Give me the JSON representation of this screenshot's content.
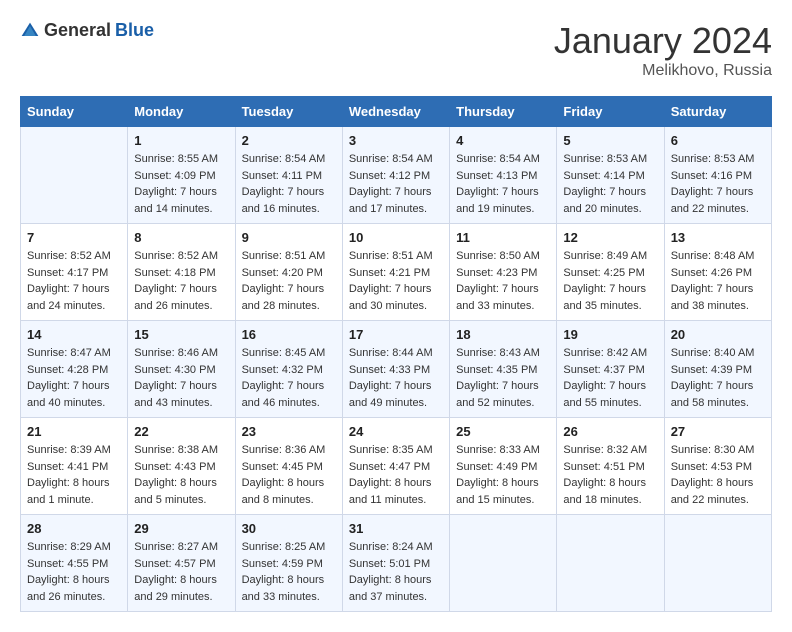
{
  "header": {
    "logo_general": "General",
    "logo_blue": "Blue",
    "month": "January 2024",
    "location": "Melikhovo, Russia"
  },
  "days_of_week": [
    "Sunday",
    "Monday",
    "Tuesday",
    "Wednesday",
    "Thursday",
    "Friday",
    "Saturday"
  ],
  "weeks": [
    [
      {
        "day": "",
        "sunrise": "",
        "sunset": "",
        "daylight": ""
      },
      {
        "day": "1",
        "sunrise": "Sunrise: 8:55 AM",
        "sunset": "Sunset: 4:09 PM",
        "daylight": "Daylight: 7 hours and 14 minutes."
      },
      {
        "day": "2",
        "sunrise": "Sunrise: 8:54 AM",
        "sunset": "Sunset: 4:11 PM",
        "daylight": "Daylight: 7 hours and 16 minutes."
      },
      {
        "day": "3",
        "sunrise": "Sunrise: 8:54 AM",
        "sunset": "Sunset: 4:12 PM",
        "daylight": "Daylight: 7 hours and 17 minutes."
      },
      {
        "day": "4",
        "sunrise": "Sunrise: 8:54 AM",
        "sunset": "Sunset: 4:13 PM",
        "daylight": "Daylight: 7 hours and 19 minutes."
      },
      {
        "day": "5",
        "sunrise": "Sunrise: 8:53 AM",
        "sunset": "Sunset: 4:14 PM",
        "daylight": "Daylight: 7 hours and 20 minutes."
      },
      {
        "day": "6",
        "sunrise": "Sunrise: 8:53 AM",
        "sunset": "Sunset: 4:16 PM",
        "daylight": "Daylight: 7 hours and 22 minutes."
      }
    ],
    [
      {
        "day": "7",
        "sunrise": "Sunrise: 8:52 AM",
        "sunset": "Sunset: 4:17 PM",
        "daylight": "Daylight: 7 hours and 24 minutes."
      },
      {
        "day": "8",
        "sunrise": "Sunrise: 8:52 AM",
        "sunset": "Sunset: 4:18 PM",
        "daylight": "Daylight: 7 hours and 26 minutes."
      },
      {
        "day": "9",
        "sunrise": "Sunrise: 8:51 AM",
        "sunset": "Sunset: 4:20 PM",
        "daylight": "Daylight: 7 hours and 28 minutes."
      },
      {
        "day": "10",
        "sunrise": "Sunrise: 8:51 AM",
        "sunset": "Sunset: 4:21 PM",
        "daylight": "Daylight: 7 hours and 30 minutes."
      },
      {
        "day": "11",
        "sunrise": "Sunrise: 8:50 AM",
        "sunset": "Sunset: 4:23 PM",
        "daylight": "Daylight: 7 hours and 33 minutes."
      },
      {
        "day": "12",
        "sunrise": "Sunrise: 8:49 AM",
        "sunset": "Sunset: 4:25 PM",
        "daylight": "Daylight: 7 hours and 35 minutes."
      },
      {
        "day": "13",
        "sunrise": "Sunrise: 8:48 AM",
        "sunset": "Sunset: 4:26 PM",
        "daylight": "Daylight: 7 hours and 38 minutes."
      }
    ],
    [
      {
        "day": "14",
        "sunrise": "Sunrise: 8:47 AM",
        "sunset": "Sunset: 4:28 PM",
        "daylight": "Daylight: 7 hours and 40 minutes."
      },
      {
        "day": "15",
        "sunrise": "Sunrise: 8:46 AM",
        "sunset": "Sunset: 4:30 PM",
        "daylight": "Daylight: 7 hours and 43 minutes."
      },
      {
        "day": "16",
        "sunrise": "Sunrise: 8:45 AM",
        "sunset": "Sunset: 4:32 PM",
        "daylight": "Daylight: 7 hours and 46 minutes."
      },
      {
        "day": "17",
        "sunrise": "Sunrise: 8:44 AM",
        "sunset": "Sunset: 4:33 PM",
        "daylight": "Daylight: 7 hours and 49 minutes."
      },
      {
        "day": "18",
        "sunrise": "Sunrise: 8:43 AM",
        "sunset": "Sunset: 4:35 PM",
        "daylight": "Daylight: 7 hours and 52 minutes."
      },
      {
        "day": "19",
        "sunrise": "Sunrise: 8:42 AM",
        "sunset": "Sunset: 4:37 PM",
        "daylight": "Daylight: 7 hours and 55 minutes."
      },
      {
        "day": "20",
        "sunrise": "Sunrise: 8:40 AM",
        "sunset": "Sunset: 4:39 PM",
        "daylight": "Daylight: 7 hours and 58 minutes."
      }
    ],
    [
      {
        "day": "21",
        "sunrise": "Sunrise: 8:39 AM",
        "sunset": "Sunset: 4:41 PM",
        "daylight": "Daylight: 8 hours and 1 minute."
      },
      {
        "day": "22",
        "sunrise": "Sunrise: 8:38 AM",
        "sunset": "Sunset: 4:43 PM",
        "daylight": "Daylight: 8 hours and 5 minutes."
      },
      {
        "day": "23",
        "sunrise": "Sunrise: 8:36 AM",
        "sunset": "Sunset: 4:45 PM",
        "daylight": "Daylight: 8 hours and 8 minutes."
      },
      {
        "day": "24",
        "sunrise": "Sunrise: 8:35 AM",
        "sunset": "Sunset: 4:47 PM",
        "daylight": "Daylight: 8 hours and 11 minutes."
      },
      {
        "day": "25",
        "sunrise": "Sunrise: 8:33 AM",
        "sunset": "Sunset: 4:49 PM",
        "daylight": "Daylight: 8 hours and 15 minutes."
      },
      {
        "day": "26",
        "sunrise": "Sunrise: 8:32 AM",
        "sunset": "Sunset: 4:51 PM",
        "daylight": "Daylight: 8 hours and 18 minutes."
      },
      {
        "day": "27",
        "sunrise": "Sunrise: 8:30 AM",
        "sunset": "Sunset: 4:53 PM",
        "daylight": "Daylight: 8 hours and 22 minutes."
      }
    ],
    [
      {
        "day": "28",
        "sunrise": "Sunrise: 8:29 AM",
        "sunset": "Sunset: 4:55 PM",
        "daylight": "Daylight: 8 hours and 26 minutes."
      },
      {
        "day": "29",
        "sunrise": "Sunrise: 8:27 AM",
        "sunset": "Sunset: 4:57 PM",
        "daylight": "Daylight: 8 hours and 29 minutes."
      },
      {
        "day": "30",
        "sunrise": "Sunrise: 8:25 AM",
        "sunset": "Sunset: 4:59 PM",
        "daylight": "Daylight: 8 hours and 33 minutes."
      },
      {
        "day": "31",
        "sunrise": "Sunrise: 8:24 AM",
        "sunset": "Sunset: 5:01 PM",
        "daylight": "Daylight: 8 hours and 37 minutes."
      },
      {
        "day": "",
        "sunrise": "",
        "sunset": "",
        "daylight": ""
      },
      {
        "day": "",
        "sunrise": "",
        "sunset": "",
        "daylight": ""
      },
      {
        "day": "",
        "sunrise": "",
        "sunset": "",
        "daylight": ""
      }
    ]
  ]
}
